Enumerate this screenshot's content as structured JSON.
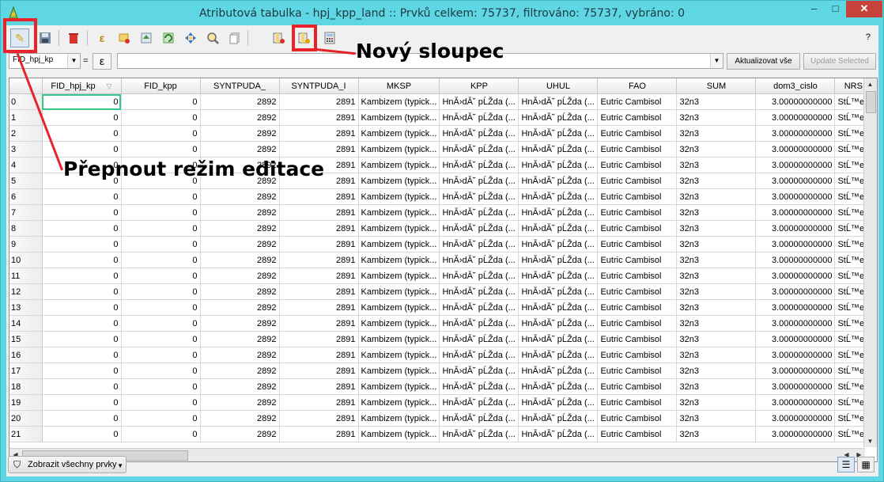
{
  "window": {
    "title": "Atributová tabulka - hpj_kpp_land :: Prvků celkem: 75737, filtrováno: 75737, vybráno: 0",
    "controls": {
      "minimize": "–",
      "maximize": "□",
      "close": "✕"
    }
  },
  "toolbar": {
    "help": "?",
    "tools": [
      {
        "name": "toggle-editing-icon",
        "glyph": "✎"
      },
      {
        "name": "save-edits-icon",
        "glyph": "💾"
      },
      {
        "name": "delete-selected-icon",
        "glyph": "🗑"
      },
      {
        "name": "select-by-expression-icon",
        "glyph": "ε"
      },
      {
        "name": "deselect-all-icon",
        "glyph": "▭"
      },
      {
        "name": "move-selection-top-icon",
        "glyph": "⇧"
      },
      {
        "name": "invert-selection-icon",
        "glyph": "⟲"
      },
      {
        "name": "pan-to-selected-icon",
        "glyph": "✥"
      },
      {
        "name": "zoom-to-selected-icon",
        "glyph": "🔍"
      },
      {
        "name": "copy-rows-icon",
        "glyph": "⎘"
      },
      {
        "name": "delete-column-icon",
        "glyph": "▥"
      },
      {
        "name": "new-column-icon",
        "glyph": "▤"
      },
      {
        "name": "field-calculator-icon",
        "glyph": "▦"
      }
    ]
  },
  "filterbar": {
    "field_select": "FID_hpj_kp",
    "equals": "=",
    "expression_button": "ε",
    "value": "",
    "update_all": "Aktualizovat vše",
    "update_selected": "Update Selected"
  },
  "table": {
    "columns": [
      "FID_hpj_kp",
      "FID_kpp",
      "SYNTPUDA_",
      "SYNTPUDA_I",
      "MKSP",
      "KPP",
      "UHUL",
      "FAO",
      "SUM",
      "dom3_cislo",
      "NRS"
    ],
    "row_template": [
      "0",
      "0",
      "2892",
      "2891",
      "Kambizem (typick...",
      "HnĂ›dĂ˘ pĹŽda (...",
      "HnĂ›dĂ˘ pĹŽda (...",
      "Eutric Cambisol",
      "32n3",
      "3.00000000000",
      "StĹ™ed"
    ],
    "rows": [
      "0",
      "1",
      "2",
      "3",
      "4",
      "5",
      "6",
      "7",
      "8",
      "9",
      "10",
      "11",
      "12",
      "13",
      "14",
      "15",
      "16",
      "17",
      "18",
      "19",
      "20",
      "21"
    ],
    "sort_indicator": "▽"
  },
  "bottom": {
    "show_all": "Zobrazit všechny prvky"
  },
  "annotations": {
    "new_column": "Nový sloupec",
    "toggle_edit": "Přepnout režim editace"
  },
  "colors": {
    "titlebar": "#5fd6e3",
    "annotation": "#e8232a",
    "focus": "#39c88a"
  }
}
